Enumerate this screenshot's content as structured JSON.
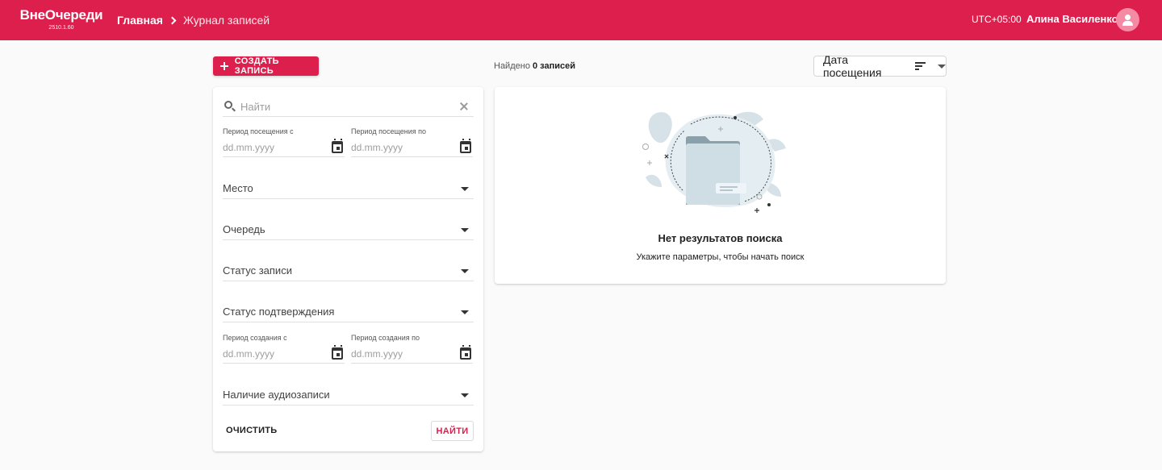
{
  "header": {
    "logo_name": "ВнеОчереди",
    "logo_version": "2510.1.60",
    "breadcrumb_home": "Главная",
    "breadcrumb_current": "Журнал записей",
    "timezone": "UTC+05:00",
    "user_name": "Алина Василенко"
  },
  "toolbar": {
    "create_label": "СОЗДАТЬ ЗАПИСЬ",
    "found_prefix": "Найдено",
    "found_count": "0 записей",
    "sort_label": "Дата посещения"
  },
  "filters": {
    "search_placeholder": "Найти",
    "visit_from_label": "Период посещения с",
    "visit_to_label": "Период посещения по",
    "date_placeholder": "dd.mm.yyyy",
    "place_label": "Место",
    "queue_label": "Очередь",
    "record_status_label": "Статус записи",
    "confirm_status_label": "Статус подтверждения",
    "created_from_label": "Период создания с",
    "created_to_label": "Период создания по",
    "audio_label": "Наличие аудиозаписи",
    "clear_label": "ОЧИСТИТЬ",
    "find_label": "НАЙТИ"
  },
  "results": {
    "empty_title": "Нет результатов поиска",
    "empty_subtitle": "Укажите параметры, чтобы начать поиск"
  },
  "icons": {
    "add": "plus-icon",
    "sort": "sort-icon",
    "search": "search-icon",
    "clear": "close-icon",
    "calendar": "calendar-icon",
    "dropdown": "chevron-down-icon",
    "avatar": "user-icon",
    "breadcrumb": "chevron-right-icon"
  },
  "colors": {
    "brand": "#dc1f4c",
    "background": "#fafafa",
    "illustration": "#cfdde4"
  }
}
